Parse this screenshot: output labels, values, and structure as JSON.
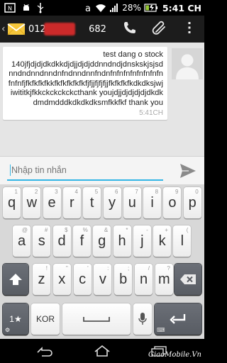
{
  "status_bar": {
    "battery": "28%",
    "time": "5:41 CH",
    "icons": [
      "usb-icon",
      "android-debug-icon",
      "nfc-icon",
      "mute-icon",
      "wifi-icon",
      "signal-icon",
      "battery-icon"
    ]
  },
  "action_bar": {
    "contact": "0124",
    "contact_suffix": "682",
    "icons": [
      "back-icon",
      "messaging-app-icon",
      "phone-icon",
      "attach-icon",
      "overflow-menu-icon"
    ]
  },
  "message": {
    "text": "test dang o stock\n140jfjdjdjdkdkkdjdjjdjdjddnndndjdnskskjsjsdnndndnndnndnfndnndnnfndnfnfnfnfnfnfnfnfnfnfnfjfkfkfkfkkfkfkfkfkfkfjfjjfjfjfjjfkfkfkfkdkdksjwjiwititkjfkkckckckckcthank youjdjjdjdjdjdjdkdkdmdmdddkdkdkdksmfkkfkf thank you",
    "time": "5:41CH"
  },
  "compose": {
    "placeholder": "Nhập tin nhắn"
  },
  "keyboard": {
    "row1": [
      {
        "k": "q",
        "h": "1"
      },
      {
        "k": "w",
        "h": "2"
      },
      {
        "k": "e",
        "h": "3"
      },
      {
        "k": "r",
        "h": "4"
      },
      {
        "k": "t",
        "h": "5"
      },
      {
        "k": "y",
        "h": "6"
      },
      {
        "k": "u",
        "h": "7"
      },
      {
        "k": "i",
        "h": "8"
      },
      {
        "k": "o",
        "h": "9"
      },
      {
        "k": "p",
        "h": "0"
      }
    ],
    "row2": [
      {
        "k": "a",
        "h": "@"
      },
      {
        "k": "s",
        "h": "#"
      },
      {
        "k": "d",
        "h": "$"
      },
      {
        "k": "f",
        "h": "%"
      },
      {
        "k": "g",
        "h": "&"
      },
      {
        "k": "h",
        "h": "*"
      },
      {
        "k": "j",
        "h": "-"
      },
      {
        "k": "k",
        "h": "+"
      },
      {
        "k": "l",
        "h": "("
      }
    ],
    "row3": [
      {
        "k": "z",
        "h": "!"
      },
      {
        "k": "x",
        "h": "\""
      },
      {
        "k": "c",
        "h": "'"
      },
      {
        "k": "v",
        "h": ":"
      },
      {
        "k": "b",
        "h": ";"
      },
      {
        "k": "n",
        "h": "/"
      },
      {
        "k": "m",
        "h": "?"
      }
    ],
    "symbols_label": "1★",
    "language_label": "KOR"
  },
  "nav": {
    "watermark": "GiaoMobile.Vn",
    "icons": [
      "back-nav-icon",
      "home-nav-icon",
      "recents-nav-icon"
    ]
  },
  "colors": {
    "accent": "#33b5e5",
    "key_dark": "#5f6369",
    "background": "#e5e5e5"
  }
}
